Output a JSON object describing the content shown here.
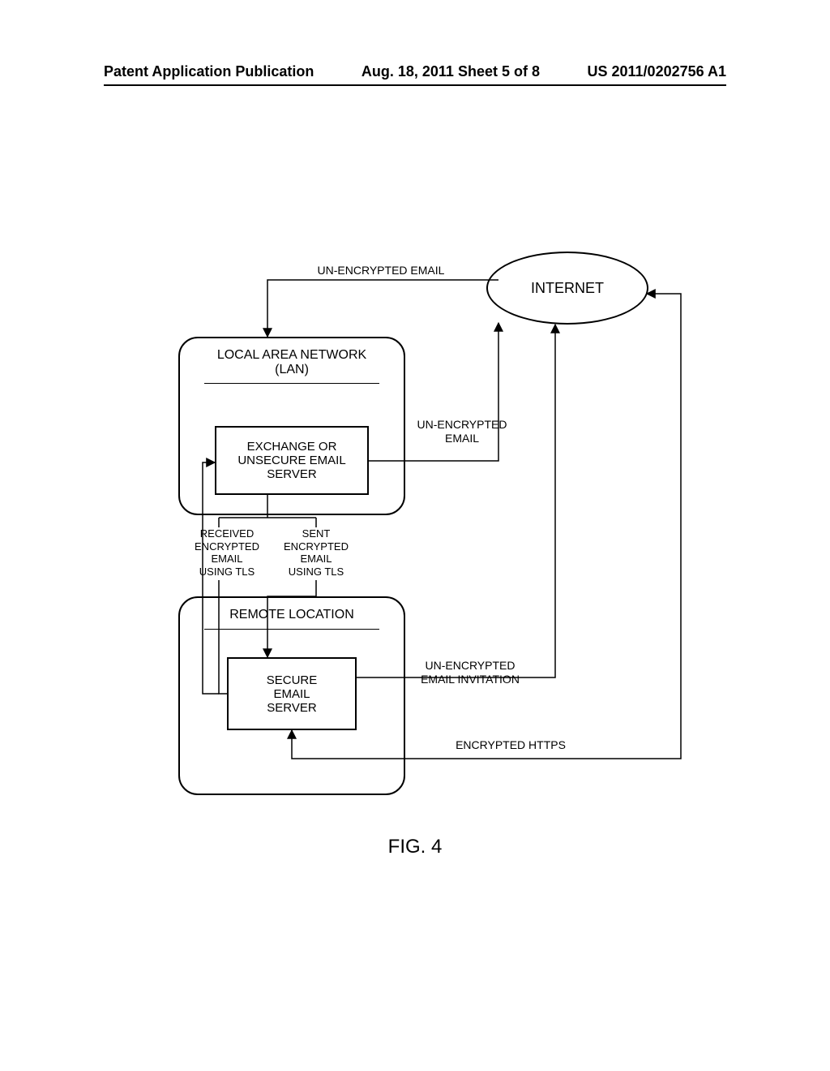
{
  "header": {
    "left": "Patent Application Publication",
    "center": "Aug. 18, 2011  Sheet 5 of 8",
    "right": "US 2011/0202756 A1"
  },
  "diagram": {
    "internet": "INTERNET",
    "lan_title": "LOCAL AREA NETWORK\n(LAN)",
    "exchange_server": "EXCHANGE OR\nUNSECURE EMAIL\nSERVER",
    "remote_title": "REMOTE LOCATION",
    "secure_server": "SECURE\nEMAIL\nSERVER",
    "labels": {
      "unencrypted_top": "UN-ENCRYPTED EMAIL",
      "unencrypted_right": "UN-ENCRYPTED\nEMAIL",
      "received_tls": "RECEIVED\nENCRYPTED\nEMAIL\nUSING TLS",
      "sent_tls": "SENT\nENCRYPTED\nEMAIL\nUSING TLS",
      "invitation": "UN-ENCRYPTED\nEMAIL INVITATION",
      "https": "ENCRYPTED HTTPS"
    }
  },
  "figure_label": "FIG. 4"
}
